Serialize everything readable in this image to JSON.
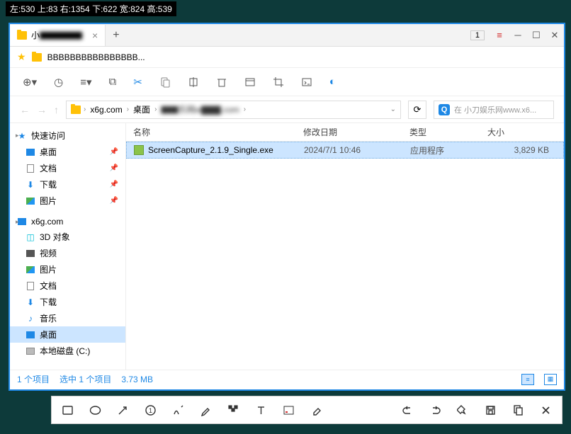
{
  "capture_info": "左:530  上:83  右:1354  下:622  宽:824  高:539",
  "tab": {
    "title": "小",
    "title_rest": "▇▇▇▇▇"
  },
  "tab_count": "1",
  "addr_path": "BBBBBBBBBBBBBBBB...",
  "breadcrumb": {
    "items": [
      "x6g.com",
      "桌面",
      "▇▇乐网w▇▇▇.com"
    ]
  },
  "search": {
    "placeholder": "在 小刀娱乐网www.x6..."
  },
  "sidebar": {
    "quick": "快速访问",
    "desktop": "桌面",
    "docs": "文档",
    "downloads": "下载",
    "pictures": "图片",
    "x6g": "x6g.com",
    "3d": "3D 对象",
    "video": "视频",
    "pictures2": "图片",
    "docs2": "文档",
    "downloads2": "下载",
    "music": "音乐",
    "desktop2": "桌面",
    "localdisk": "本地磁盘 (C:)"
  },
  "columns": {
    "name": "名称",
    "date": "修改日期",
    "type": "类型",
    "size": "大小"
  },
  "file": {
    "name": "ScreenCapture_2.1.9_Single.exe",
    "date": "2024/7/1 10:46",
    "type": "应用程序",
    "size": "3,829 KB"
  },
  "status": {
    "count": "1 个项目",
    "selected": "选中 1 个项目",
    "size": "3.73 MB"
  }
}
